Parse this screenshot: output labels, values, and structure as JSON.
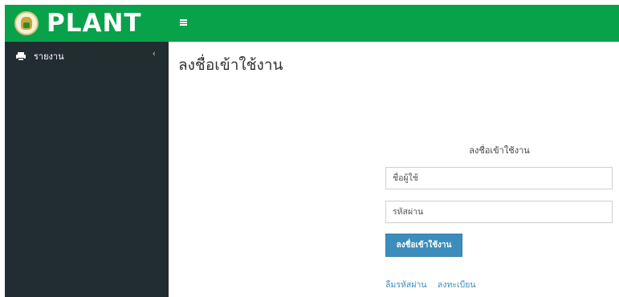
{
  "brand": {
    "title": "PLANT"
  },
  "sidebar": {
    "items": [
      {
        "label": "รายงาน",
        "icon": "printer-icon",
        "chevron": "‹"
      }
    ]
  },
  "navbar": {
    "menu_icon": "hamburger-icon"
  },
  "page": {
    "title": "ลงชื่อเข้าใช้งาน"
  },
  "login": {
    "heading": "ลงชื่อเข้าใช้งาน",
    "username_placeholder": "ชื่อผู้ใช้",
    "password_placeholder": "รหัสผ่าน",
    "submit_label": "ลงชื่อเข้าใช้งาน",
    "forgot_label": "ลืมรหัสผ่าน",
    "register_label": "ลงทะเบียน"
  },
  "colors": {
    "brand_green": "#08a24b",
    "sidebar_bg": "#222d32",
    "primary_blue": "#3c8dbc"
  }
}
